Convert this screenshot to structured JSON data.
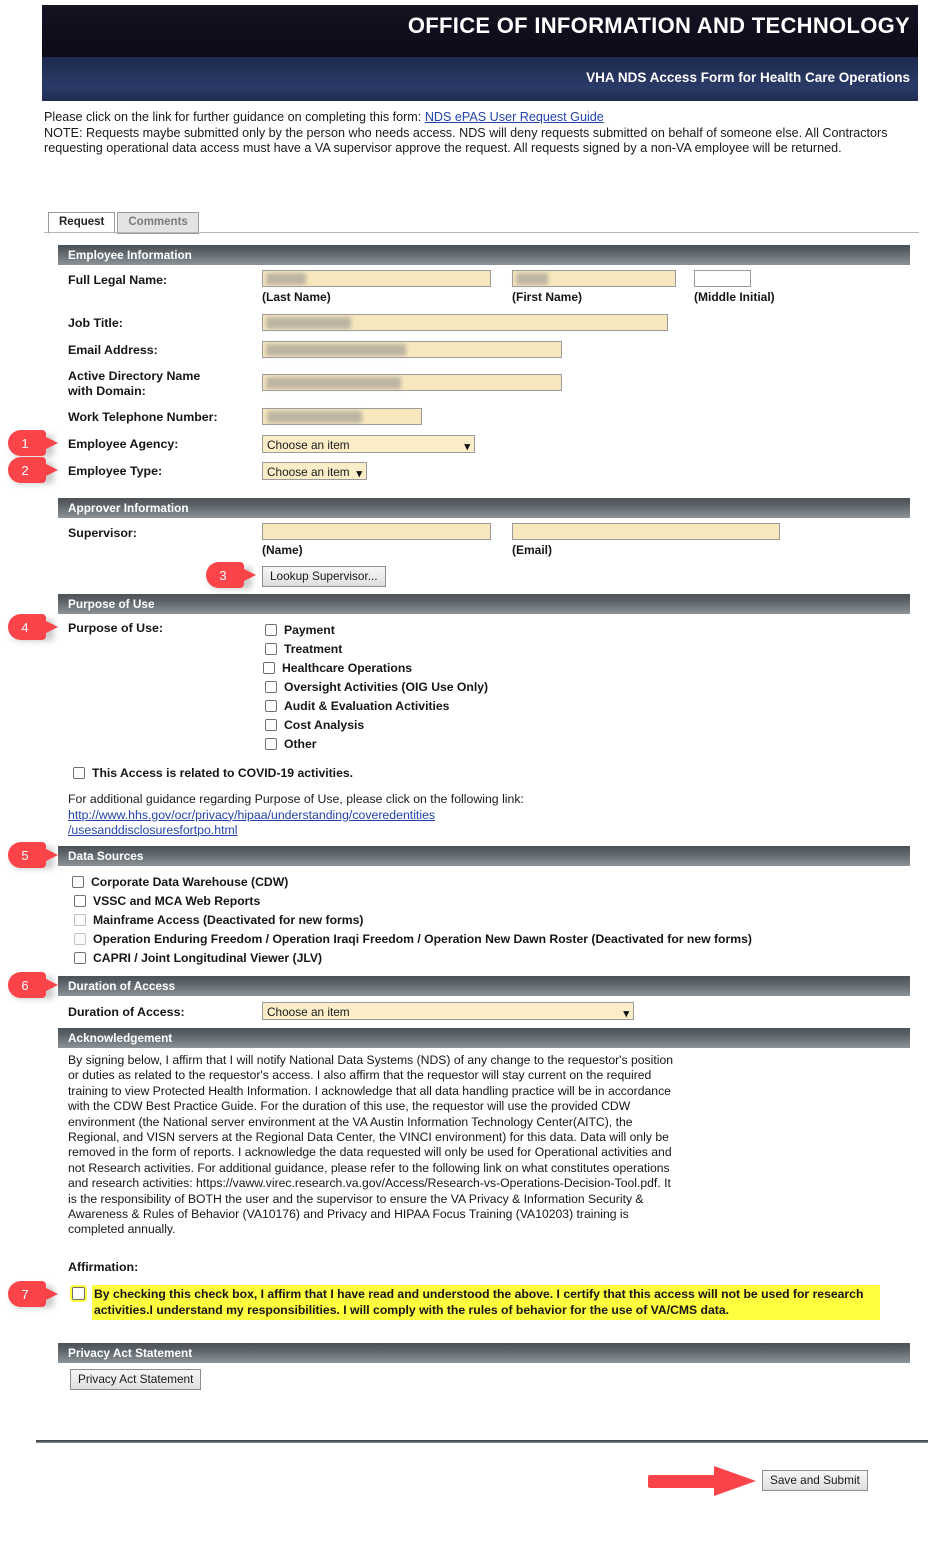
{
  "banner": {
    "org_title": "OFFICE OF INFORMATION AND TECHNOLOGY",
    "form_title": "VHA NDS Access Form for Health Care Operations"
  },
  "intro": {
    "line1_prefix": "Please click on the link for further guidance on completing this form: ",
    "guide_link": "NDS ePAS User Request Guide",
    "note": "NOTE: Requests maybe submitted only by the person who needs access. NDS will deny requests submitted on behalf of someone else. All Contractors requesting operational data access must have a VA supervisor approve the request. All requests signed by a non-VA employee will be returned."
  },
  "tabs": [
    {
      "label": "Request",
      "active": true
    },
    {
      "label": "Comments",
      "active": false
    }
  ],
  "employee_information": {
    "section_title": "Employee Information",
    "full_legal_name_label": "Full Legal Name:",
    "last_name_caption": "(Last Name)",
    "first_name_caption": "(First Name)",
    "middle_initial_caption": "(Middle Initial)",
    "last_name_value": "",
    "first_name_value": "",
    "middle_initial_value": "",
    "job_title_label": "Job Title:",
    "job_title_value": "",
    "email_label": "Email Address:",
    "email_value": "",
    "ad_name_label_line1": "Active Directory Name",
    "ad_name_label_line2": "with Domain:",
    "ad_name_value": "",
    "work_phone_label": "Work Telephone Number:",
    "work_phone_value": "",
    "employee_agency_label": "Employee Agency:",
    "employee_agency_value": "Choose an item",
    "employee_type_label": "Employee Type:",
    "employee_type_value": "Choose an item"
  },
  "approver_information": {
    "section_title": "Approver Information",
    "supervisor_label": "Supervisor:",
    "name_caption": "(Name)",
    "email_caption": "(Email)",
    "supervisor_name_value": "",
    "supervisor_email_value": "",
    "lookup_button": "Lookup Supervisor..."
  },
  "purpose_of_use": {
    "section_title": "Purpose of Use",
    "field_label": "Purpose of Use:",
    "options": [
      {
        "label": "Payment",
        "checked": false,
        "highlighted": false,
        "disabled": false
      },
      {
        "label": "Treatment",
        "checked": false,
        "highlighted": false,
        "disabled": false
      },
      {
        "label": "Healthcare Operations",
        "checked": false,
        "highlighted": true,
        "disabled": false
      },
      {
        "label": "Oversight Activities (OIG Use Only)",
        "checked": false,
        "highlighted": false,
        "disabled": false
      },
      {
        "label": "Audit & Evaluation Activities",
        "checked": false,
        "highlighted": false,
        "disabled": false
      },
      {
        "label": "Cost Analysis",
        "checked": false,
        "highlighted": false,
        "disabled": false
      },
      {
        "label": "Other",
        "checked": false,
        "highlighted": false,
        "disabled": false
      }
    ],
    "covid_label": "This Access is related to COVID-19 activities.",
    "covid_checked": false,
    "guidance_text": "For additional guidance regarding Purpose of Use, please click on the following link:",
    "guidance_link_line1": "http://www.hhs.gov/ocr/privacy/hipaa/understanding/coveredentities",
    "guidance_link_line2": "/usesanddisclosuresfortpo.html"
  },
  "data_sources": {
    "section_title": "Data Sources",
    "options": [
      {
        "label": "Corporate Data Warehouse (CDW)",
        "checked": false,
        "highlighted": true,
        "disabled": false
      },
      {
        "label": "VSSC and MCA Web Reports",
        "checked": false,
        "highlighted": false,
        "disabled": false
      },
      {
        "label": "Mainframe Access (Deactivated for new forms)",
        "checked": false,
        "highlighted": false,
        "disabled": true
      },
      {
        "label": "Operation Enduring Freedom / Operation Iraqi Freedom / Operation New Dawn Roster (Deactivated for new forms)",
        "checked": false,
        "highlighted": false,
        "disabled": true
      },
      {
        "label": "CAPRI / Joint Longitudinal Viewer (JLV)",
        "checked": false,
        "highlighted": false,
        "disabled": false
      }
    ]
  },
  "duration_of_access": {
    "section_title": "Duration of Access",
    "field_label": "Duration of Access:",
    "value": "Choose an item"
  },
  "acknowledgement": {
    "section_title": "Acknowledgement",
    "body": "By signing below, I affirm that I will notify National Data Systems (NDS) of any change to the requestor's position or duties as related to the requestor's access. I also affirm that the requestor will stay current on the required training to view Protected Health Information. I acknowledge that all data handling practice will be in accordance with the CDW Best Practice Guide. For the duration of this use, the requestor will use the provided CDW environment (the National server environment at the VA Austin Information Technology Center(AITC), the Regional, and VISN servers at the Regional Data Center, the VINCI environment) for this data. Data will only be removed in the form of reports. I acknowledge the data requested will only be used for Operational activities and not Research activities. For additional guidance, please refer to the following link on what constitutes operations and research activities: https://vaww.virec.research.va.gov/Access/Research-vs-Operations-Decision-Tool.pdf. It is the responsibility of BOTH the user and the supervisor to ensure the VA Privacy & Information Security & Awareness & Rules of Behavior (VA10176) and Privacy and HIPAA Focus Training (VA10203) training is completed annually.",
    "affirmation_label": "Affirmation:",
    "affirmation_text": "By checking this check box, I affirm that I have read and understood the above. I certify that this access will not be used for research activities.I understand my responsibilities. I will comply with the rules of behavior for the use of VA/CMS data.",
    "affirmation_checked": false
  },
  "privacy_act": {
    "section_title": "Privacy Act Statement",
    "button_label": "Privacy Act Statement"
  },
  "footer": {
    "submit_button": "Save and Submit"
  },
  "callouts": [
    {
      "number": "1"
    },
    {
      "number": "2"
    },
    {
      "number": "3"
    },
    {
      "number": "4"
    },
    {
      "number": "5"
    },
    {
      "number": "6"
    },
    {
      "number": "7"
    }
  ],
  "colors": {
    "accent_red": "#fa4449",
    "highlight_yellow": "#ffff3f",
    "field_yellow": "#faedc8",
    "banner_navy": "#26345d",
    "banner_black": "#100e1c",
    "section_gray": "#6e767b",
    "link_blue": "#2244aa"
  }
}
